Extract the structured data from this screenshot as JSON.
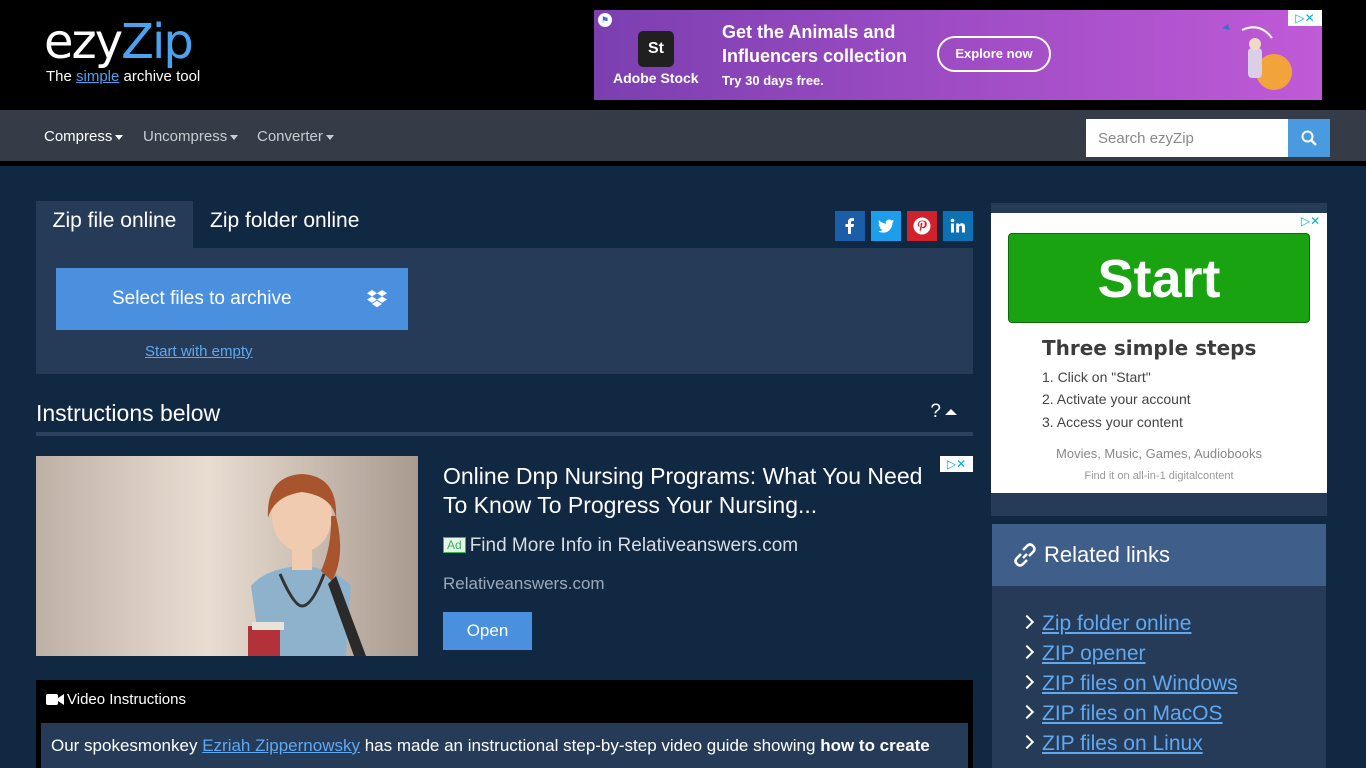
{
  "brand": {
    "name_part1": "ezy",
    "name_part2": "Zip",
    "tagline_before": "The ",
    "tagline_em": "simple",
    "tagline_after": " archive tool",
    "accent_color": "#4aa3f0"
  },
  "top_ad": {
    "brand": "Adobe Stock",
    "logo_text": "St",
    "headline": "Get the Animals and Influencers collection",
    "subtext": "Try 30 days free.",
    "cta": "Explore now"
  },
  "nav": {
    "items": [
      {
        "label": "Compress",
        "active": true
      },
      {
        "label": "Uncompress",
        "active": false
      },
      {
        "label": "Converter",
        "active": false
      }
    ],
    "search_placeholder": "Search ezyZip"
  },
  "tabs": [
    {
      "label": "Zip file online",
      "active": true
    },
    {
      "label": "Zip folder online",
      "active": false
    }
  ],
  "share_icons": [
    "facebook-icon",
    "twitter-icon",
    "pinterest-icon",
    "linkedin-icon"
  ],
  "upload": {
    "select_label": "Select files to archive",
    "start_empty": "Start with empty"
  },
  "instructions": {
    "heading": "Instructions below",
    "toggle": "?"
  },
  "native_ad": {
    "title": "Online Dnp Nursing Programs: What You Need To Know To Progress Your Nursing...",
    "badge": "Ad",
    "line": "Find More Info in Relativeanswers.com",
    "domain": "Relativeanswers.com",
    "cta": "Open"
  },
  "video": {
    "heading": "Video Instructions",
    "text_before": "Our spokesmonkey ",
    "link": "Ezriah Zippernowsky",
    "text_after": " has made an instructional step-by-step video guide showing ",
    "bold": "how to create"
  },
  "side_ad": {
    "button": "Start",
    "title": "Three simple steps",
    "steps": [
      "1. Click on \"Start\"",
      "2. Activate your account",
      "3. Access your content"
    ],
    "footer1": "Movies, Music, Games, Audiobooks",
    "footer2": "Find it on all-in-1 digitalcontent"
  },
  "related": {
    "heading": "Related links",
    "links": [
      "Zip folder online",
      "ZIP opener",
      "ZIP files on Windows",
      "ZIP files on MacOS",
      "ZIP files on Linux"
    ]
  }
}
